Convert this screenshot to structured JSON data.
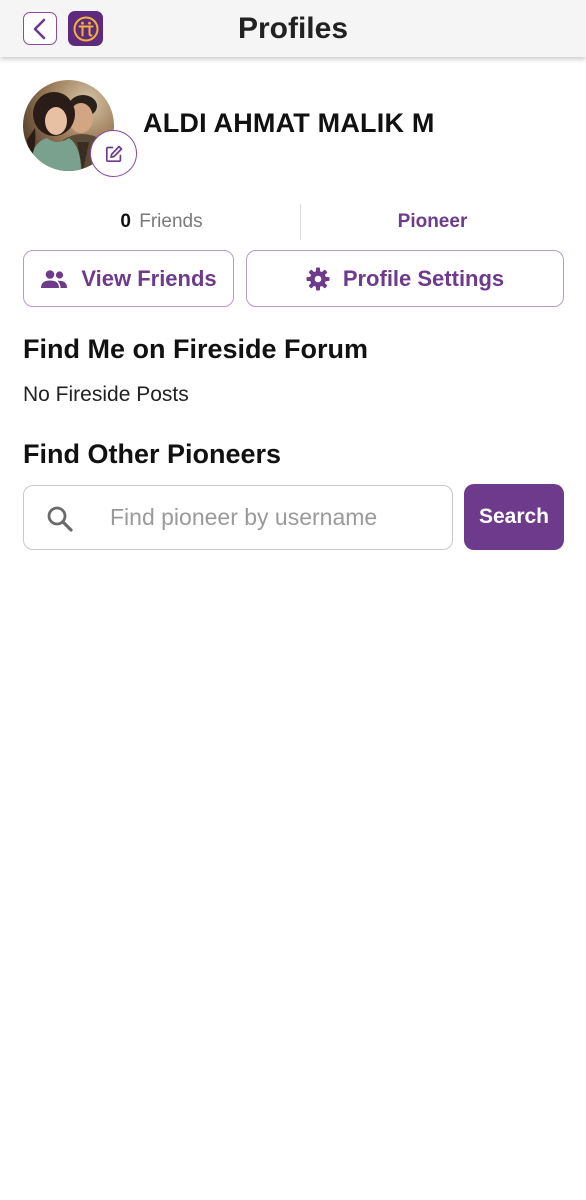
{
  "header": {
    "title": "Profiles",
    "back_icon": "chevron-left-icon",
    "logo_icon": "pi-logo-icon",
    "logo_symbol": "π"
  },
  "profile": {
    "username": "ALDI AHMAT MALIK M",
    "avatar_icon": "profile-photo",
    "edit_icon": "edit-pencil-icon"
  },
  "stats": {
    "friends_count": "0",
    "friends_label": "Friends",
    "role": "Pioneer"
  },
  "actions": {
    "view_friends_label": "View Friends",
    "view_friends_icon": "people-icon",
    "profile_settings_label": "Profile Settings",
    "profile_settings_icon": "gear-icon"
  },
  "fireside": {
    "title": "Find Me on Fireside Forum",
    "empty_text": "No Fireside Posts"
  },
  "find_pioneers": {
    "title": "Find Other Pioneers",
    "search_placeholder": "Find pioneer by username",
    "search_value": "",
    "search_button_label": "Search",
    "search_icon": "search-icon"
  },
  "colors": {
    "accent": "#6e3a8c",
    "logo_bg": "#5d2a7e",
    "logo_fg": "#f2b13a",
    "border": "#b69cc2",
    "muted_text": "#7a7a7a",
    "topbar_bg": "#f5f5f5"
  }
}
